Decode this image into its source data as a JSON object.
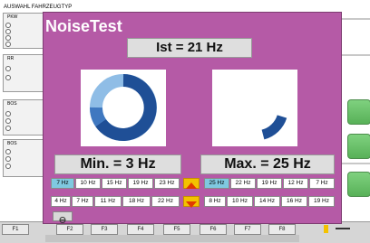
{
  "background_app": {
    "title": "AUSWAHL FAHRZEUGTYP",
    "panel_labels": [
      "PKW",
      "RR",
      "BOS",
      "BOS"
    ],
    "keys": [
      "F1",
      "F2",
      "F3",
      "F4",
      "F5",
      "F6",
      "F7",
      "F8"
    ]
  },
  "dialog": {
    "title": "NoiseTest",
    "current": "Ist = 21 Hz",
    "min": "Min. = 3 Hz",
    "max": "Max. = 25 Hz",
    "left_history_row1": [
      "7 Hz",
      "10 Hz",
      "15 Hz",
      "19 Hz",
      "23 Hz"
    ],
    "left_history_row2": [
      "4 Hz",
      "7 Hz",
      "11 Hz",
      "18 Hz",
      "22 Hz"
    ],
    "right_history_row1": [
      "25 Hz",
      "22 Hz",
      "19 Hz",
      "12 Hz",
      "7 Hz"
    ],
    "right_history_row2": [
      "8 Hz",
      "10 Hz",
      "14 Hz",
      "16 Hz",
      "19 Hz"
    ],
    "colors": {
      "dialog_bg": "#b55aa6",
      "gauge_dark": "#1f4f96",
      "gauge_light": "#8fbde6",
      "selected_cell": "#7fc9e0",
      "arrow": "#f4c200",
      "arrow_mark": "#e03a00"
    }
  }
}
